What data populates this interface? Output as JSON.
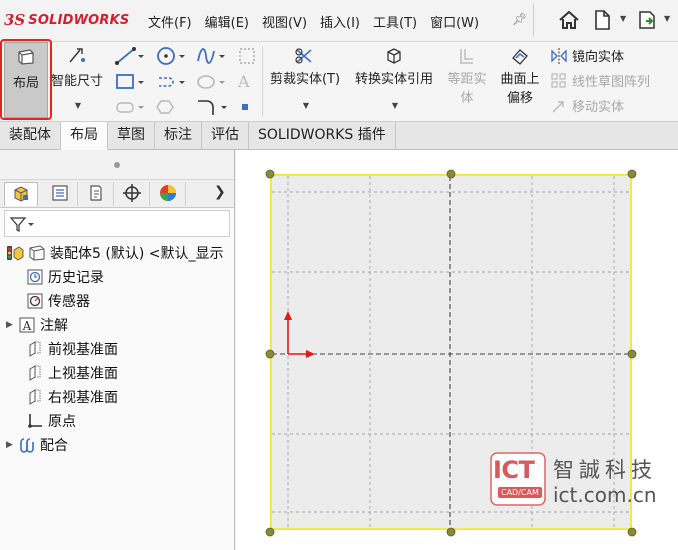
{
  "app": {
    "logo_symbol": "3S",
    "logo_text": "SOLIDWORKS"
  },
  "menu": [
    "文件(F)",
    "编辑(E)",
    "视图(V)",
    "插入(I)",
    "工具(T)",
    "窗口(W)"
  ],
  "commands": {
    "layout": "布局",
    "smart_dimension": "智能尺寸",
    "trim_entities": "剪裁实体(T)",
    "convert_entities": "转换实体引用",
    "offset_entities_line1": "等距实",
    "offset_entities_line2": "体",
    "offset_on_surface_line1": "曲面上",
    "offset_on_surface_line2": "偏移",
    "mirror_entities": "镜向实体",
    "linear_pattern": "线性草图阵列",
    "move_entities": "移动实体"
  },
  "tabs": [
    "装配体",
    "布局",
    "草图",
    "标注",
    "评估",
    "SOLIDWORKS 插件"
  ],
  "active_tab": "布局",
  "tree": {
    "root": "装配体5 (默认) <默认_显示",
    "items": [
      "历史记录",
      "传感器",
      "注解",
      "前视基准面",
      "上视基准面",
      "右视基准面",
      "原点",
      "配合"
    ]
  },
  "watermark": {
    "logo": "ICT",
    "logo_sub": "CAD/CAM",
    "name": "智誠科技",
    "url": "ict.com.cn"
  },
  "colors": {
    "accent_red": "#e8231f",
    "sheet_border": "#f2e84a",
    "logo_red": "#d0202f"
  }
}
